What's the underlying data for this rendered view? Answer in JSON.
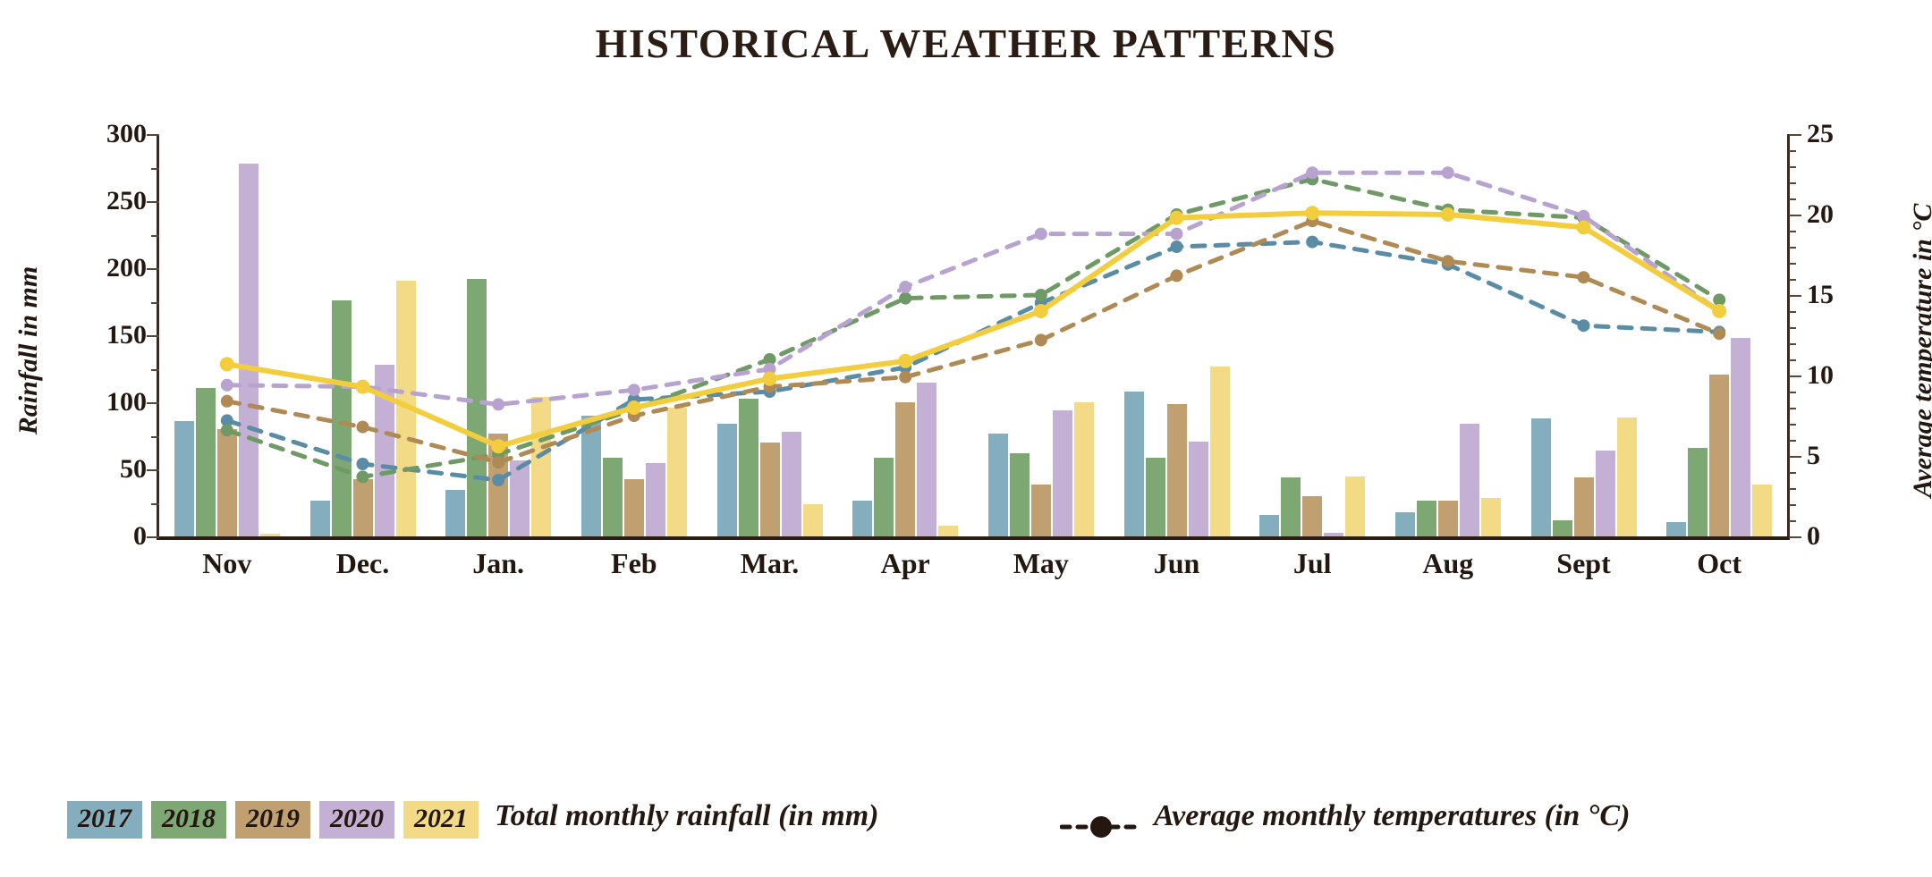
{
  "title": "HISTORICAL WEATHER PATTERNS",
  "axes": {
    "left_title": "Rainfall in mm",
    "right_title": "Average temperature in °C",
    "left_ticks": [
      "300",
      "250",
      "200",
      "150",
      "100",
      "50",
      "0"
    ],
    "right_ticks": [
      "25",
      "20",
      "15",
      "10",
      "5",
      "0"
    ]
  },
  "legend": {
    "years": [
      {
        "label": "2017",
        "color": "#84adbe"
      },
      {
        "label": "2018",
        "color": "#7da874"
      },
      {
        "label": "2019",
        "color": "#c0a070"
      },
      {
        "label": "2020",
        "color": "#c4b0d4"
      },
      {
        "label": "2021",
        "color": "#f3da86"
      }
    ],
    "rainfall_label": "Total monthly rainfall (in mm)",
    "temperature_label": "Average monthly temperatures (in °C)",
    "temperature_symbol": "dashed-line-with-dot-marker"
  },
  "chart_data": {
    "type": "bar",
    "title": "HISTORICAL WEATHER PATTERNS",
    "xlabel": "",
    "ylabel": "Rainfall in mm",
    "ylabel_secondary": "Average temperature in °C",
    "ylim": [
      0,
      300
    ],
    "ylim_secondary": [
      0,
      25
    ],
    "grid": false,
    "legend_position": "bottom",
    "categories": [
      "Nov",
      "Dec.",
      "Jan.",
      "Feb",
      "Mar.",
      "Apr",
      "May",
      "Jun",
      "Jul",
      "Aug",
      "Sept",
      "Oct"
    ],
    "series": [
      {
        "name": "2017",
        "type": "bar",
        "color": "#84adbe",
        "unit": "mm",
        "values": [
          86,
          27,
          35,
          90,
          84,
          27,
          77,
          108,
          16,
          18,
          88,
          11
        ]
      },
      {
        "name": "2018",
        "type": "bar",
        "color": "#7da874",
        "unit": "mm",
        "values": [
          111,
          176,
          192,
          59,
          103,
          59,
          62,
          59,
          44,
          27,
          12,
          66
        ]
      },
      {
        "name": "2019",
        "type": "bar",
        "color": "#c0a070",
        "unit": "mm",
        "values": [
          80,
          43,
          77,
          43,
          70,
          100,
          39,
          99,
          30,
          27,
          44,
          121
        ]
      },
      {
        "name": "2020",
        "type": "bar",
        "color": "#c4b0d4",
        "unit": "mm",
        "values": [
          278,
          128,
          57,
          55,
          78,
          115,
          94,
          71,
          3,
          84,
          64,
          148
        ]
      },
      {
        "name": "2021",
        "type": "bar",
        "color": "#f3da86",
        "unit": "mm",
        "values": [
          2,
          191,
          104,
          96,
          24,
          8,
          100,
          127,
          45,
          29,
          89,
          39
        ]
      },
      {
        "name": "2017",
        "type": "line",
        "style": "dashed",
        "color": "#5b8ca5",
        "unit": "°C",
        "axis": "secondary",
        "values": [
          7.2,
          4.5,
          3.5,
          8.5,
          9.0,
          10.5,
          14.5,
          18.0,
          18.3,
          16.9,
          13.1,
          12.7
        ]
      },
      {
        "name": "2018",
        "type": "line",
        "style": "dashed",
        "color": "#6f9a66",
        "unit": "°C",
        "axis": "secondary",
        "values": [
          6.6,
          3.7,
          5.1,
          7.9,
          11.0,
          14.8,
          15.0,
          20.0,
          22.2,
          20.3,
          19.8,
          14.7
        ]
      },
      {
        "name": "2019",
        "type": "line",
        "style": "dashed",
        "color": "#b08a54",
        "unit": "°C",
        "axis": "secondary",
        "values": [
          8.4,
          6.8,
          4.6,
          7.5,
          9.3,
          9.9,
          12.2,
          16.2,
          19.6,
          17.1,
          16.1,
          12.6
        ]
      },
      {
        "name": "2020",
        "type": "line",
        "style": "dashed",
        "color": "#b8a2cf",
        "unit": "°C",
        "axis": "secondary",
        "values": [
          9.4,
          9.3,
          8.2,
          9.1,
          10.4,
          15.5,
          18.8,
          18.8,
          22.6,
          22.6,
          19.9,
          14.0
        ]
      },
      {
        "name": "2021",
        "type": "line",
        "style": "solid",
        "color": "#f2ce3e",
        "unit": "°C",
        "axis": "secondary",
        "values": [
          10.7,
          9.3,
          5.6,
          8.0,
          9.8,
          10.9,
          14.0,
          19.8,
          20.1,
          20.0,
          19.2,
          14.0
        ]
      }
    ]
  }
}
